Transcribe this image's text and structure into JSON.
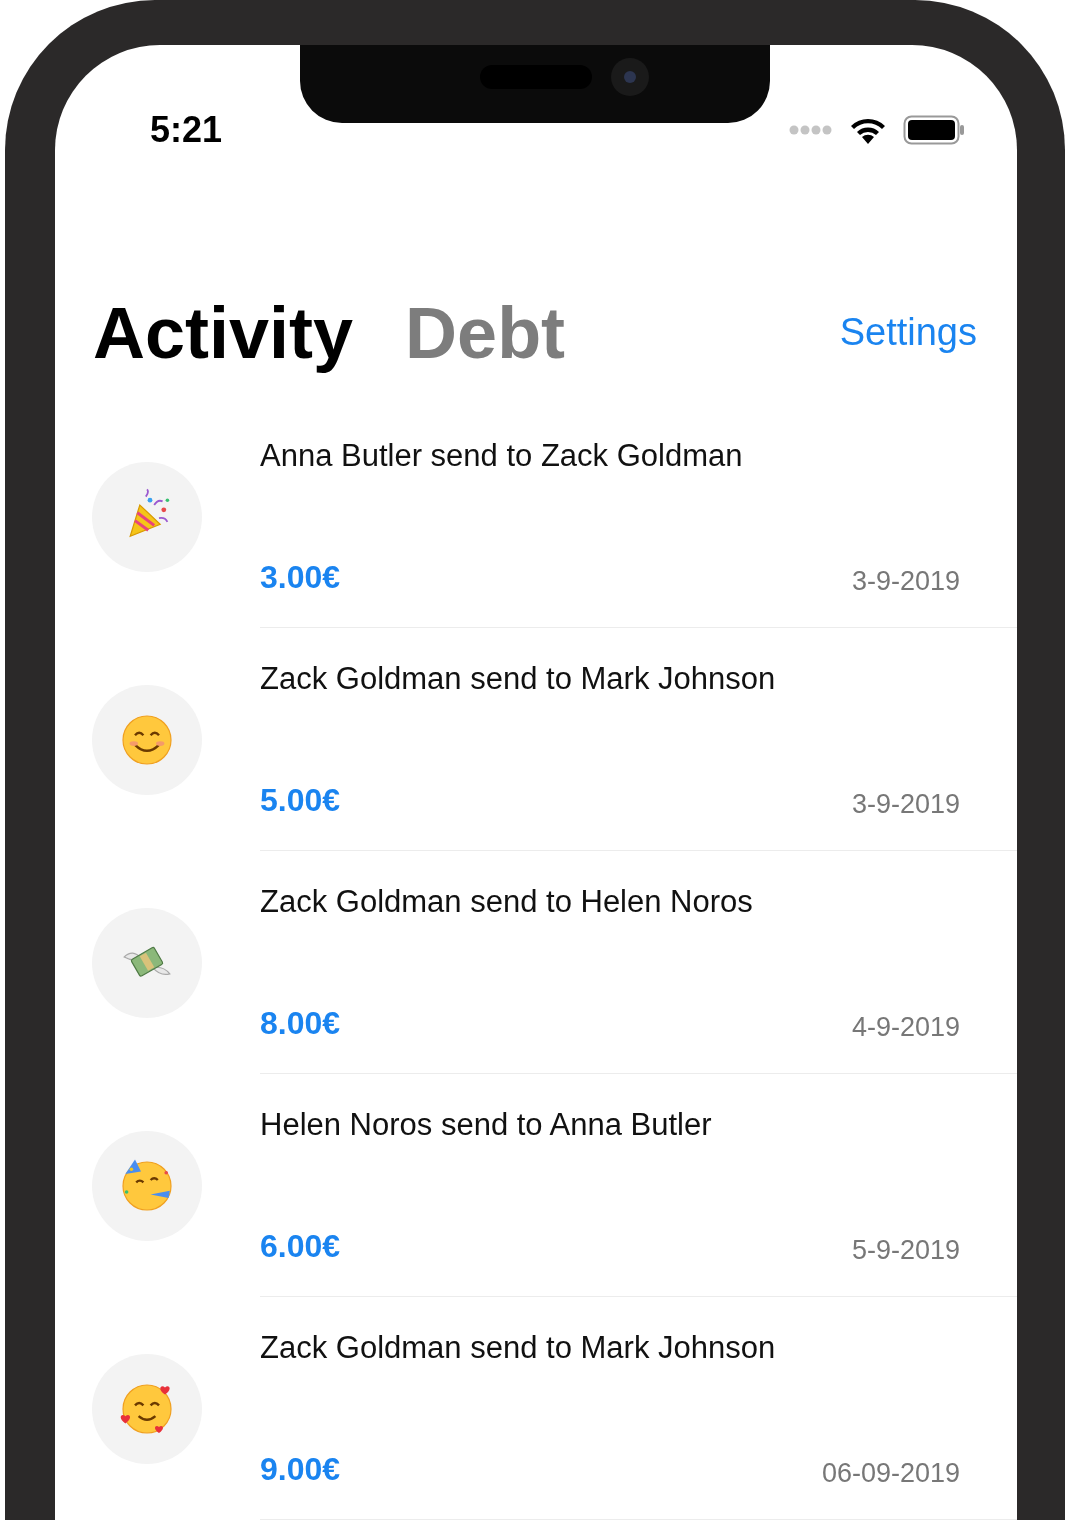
{
  "status_bar": {
    "time": "5:21"
  },
  "tabs": [
    {
      "label": "Activity",
      "selected": true
    },
    {
      "label": "Debt",
      "selected": false
    }
  ],
  "settings_link": "Settings",
  "activities": [
    {
      "title": "Anna Butler send to Zack Goldman",
      "amount": "3.00€",
      "date": "3-9-2019"
    },
    {
      "title": "Zack Goldman send to Mark Johnson",
      "amount": "5.00€",
      "date": "3-9-2019"
    },
    {
      "title": "Zack Goldman send to Helen Noros",
      "amount": "8.00€",
      "date": "4-9-2019"
    },
    {
      "title": "Helen Noros send to Anna Butler",
      "amount": "6.00€",
      "date": "5-9-2019"
    },
    {
      "title": "Zack Goldman send to Mark Johnson",
      "amount": "9.00€",
      "date": "06-09-2019"
    }
  ]
}
